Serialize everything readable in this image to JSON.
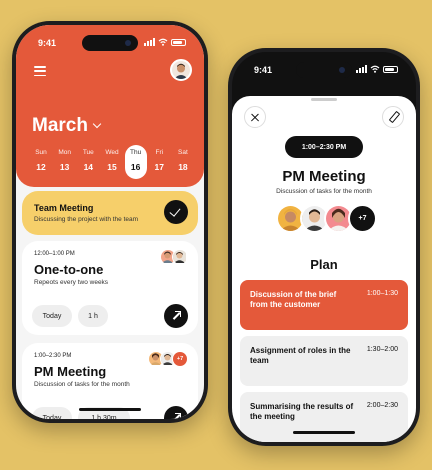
{
  "left_phone": {
    "status_time": "9:41",
    "calendar": {
      "month": "March",
      "days": [
        {
          "name": "Sun",
          "date": "12"
        },
        {
          "name": "Mon",
          "date": "13"
        },
        {
          "name": "Tue",
          "date": "14"
        },
        {
          "name": "Wed",
          "date": "15"
        },
        {
          "name": "Thu",
          "date": "16"
        },
        {
          "name": "Fri",
          "date": "17"
        },
        {
          "name": "Sat",
          "date": "18"
        }
      ],
      "selected_date": "16"
    },
    "cards": {
      "team_meeting": {
        "title": "Team Meeting",
        "subtitle": "Discussing the project with the team"
      },
      "one_to_one": {
        "time": "12:00–1:00 PM",
        "title": "One-to-one",
        "subtitle": "Repeots every two weeks",
        "pill_day": "Today",
        "pill_duration": "1 h"
      },
      "pm_meeting": {
        "time": "1:00–2:30 PM",
        "title": "PM Meeting",
        "subtitle": "Discussion of tasks for the month",
        "pill_day": "Today",
        "pill_duration": "1 h 30m",
        "more_count": "+7"
      }
    }
  },
  "right_phone": {
    "status_time": "9:41",
    "time_range": "1:00–2:30 PM",
    "title": "PM Meeting",
    "subtitle": "Discussion of tasks for the month",
    "more_count": "+7",
    "plan_heading": "Plan",
    "plan_items": [
      {
        "title": "Discussion of the brief from the customer",
        "time": "1:00–1:30"
      },
      {
        "title": "Assignment of roles in the team",
        "time": "1:30–2:00"
      },
      {
        "title": "Summarising the results of the meeting",
        "time": "2:00–2:30"
      }
    ]
  },
  "colors": {
    "background": "#e4c266",
    "accent_orange": "#e4593a",
    "accent_yellow": "#f6cf6a",
    "dark": "#111111"
  }
}
